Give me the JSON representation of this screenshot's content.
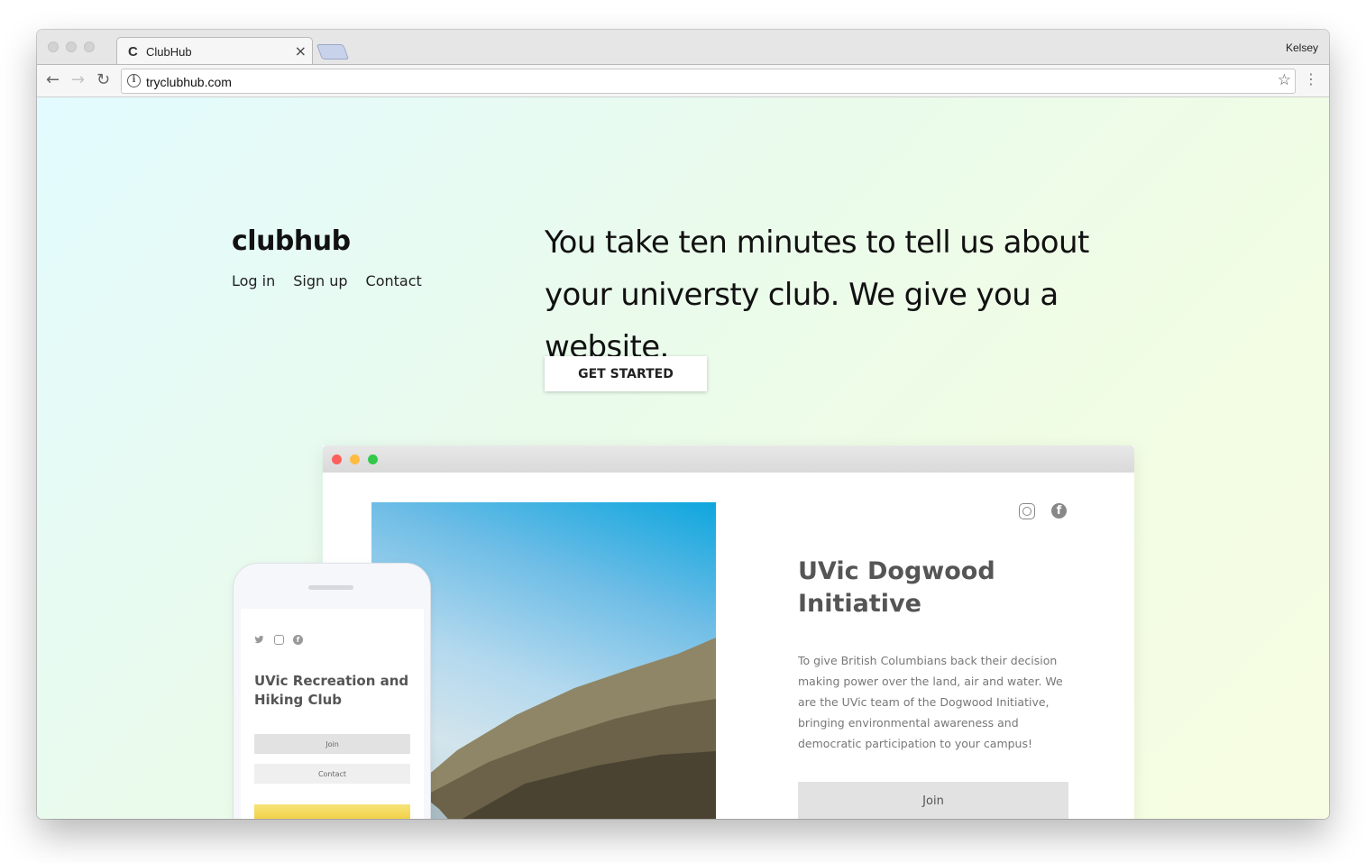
{
  "browser": {
    "tab_title": "ClubHub",
    "tab_favicon": "clubhub-logo-icon",
    "profile_name": "Kelsey",
    "url": "tryclubhub.com"
  },
  "site": {
    "logo": "clubhub",
    "nav": [
      "Log in",
      "Sign up",
      "Contact"
    ],
    "headline": "You take ten minutes to tell us about your universty club. We give you a website.",
    "cta": "GET STARTED"
  },
  "desktop_mockup": {
    "club_title": "UVic Dogwood Initiative",
    "description": "To give British Columbians back their decision making power over the land, air and water. We are the UVic team of the Dogwood Initiative, bringing environmental awareness and democratic participation to your campus!",
    "join_label": "Join",
    "social_icons": [
      "instagram-icon",
      "facebook-icon"
    ]
  },
  "phone_mockup": {
    "club_title": "UVic Recreation and Hiking Club",
    "join_label": "Join",
    "contact_label": "Contact",
    "social_icons": [
      "twitter-icon",
      "instagram-icon",
      "facebook-icon"
    ]
  },
  "colors": {
    "dot_red": "#fc605c",
    "dot_yellow": "#fdbc40",
    "dot_green": "#34c84a",
    "hero_sky": "#0ea6de"
  }
}
